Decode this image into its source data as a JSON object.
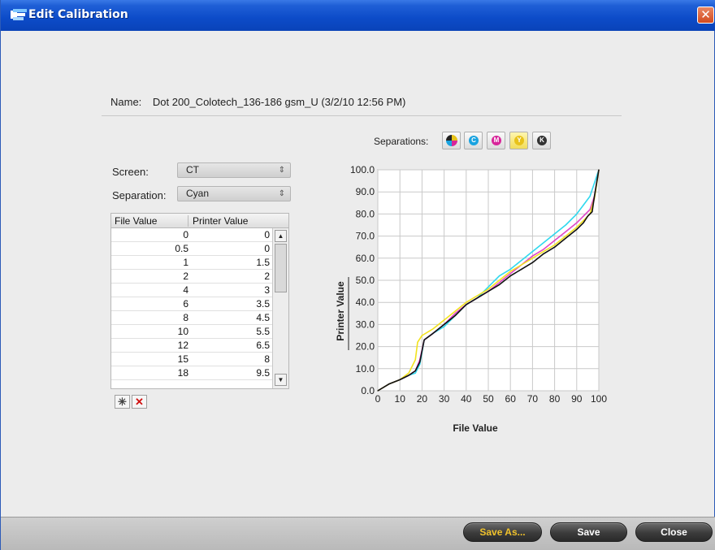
{
  "window": {
    "title": "Edit Calibration",
    "close_glyph": "✕",
    "icon": "app-logo-icon"
  },
  "name_row": {
    "label": "Name:",
    "value": "Dot 200_Colotech_136-186 gsm_U (3/2/10 12:56 PM)"
  },
  "screen": {
    "label": "Screen:",
    "value": "CT"
  },
  "separation": {
    "label": "Separation:",
    "value": "Cyan"
  },
  "table": {
    "headers": [
      "File Value",
      "Printer Value"
    ],
    "rows": [
      [
        "0",
        "0"
      ],
      [
        "0.5",
        "0"
      ],
      [
        "1",
        "1.5"
      ],
      [
        "2",
        "2"
      ],
      [
        "4",
        "3"
      ],
      [
        "6",
        "3.5"
      ],
      [
        "8",
        "4.5"
      ],
      [
        "10",
        "5.5"
      ],
      [
        "12",
        "6.5"
      ],
      [
        "15",
        "8"
      ],
      [
        "18",
        "9.5"
      ]
    ]
  },
  "toolbar": {
    "add_glyph": "✳",
    "delete_glyph": "✕"
  },
  "separations": {
    "label": "Separations:",
    "buttons": [
      {
        "name": "all",
        "glyph": "",
        "color": "multi"
      },
      {
        "name": "cyan",
        "glyph": "C",
        "color": "#1aa3e0"
      },
      {
        "name": "magenta",
        "glyph": "M",
        "color": "#d8259a"
      },
      {
        "name": "yellow",
        "glyph": "Y",
        "color": "#e8c21a"
      },
      {
        "name": "black",
        "glyph": "K",
        "color": "#333333"
      }
    ]
  },
  "chart_data": {
    "type": "line",
    "xlabel": "File Value",
    "ylabel": "Printer Value",
    "xlim": [
      0,
      100
    ],
    "ylim": [
      0,
      100
    ],
    "x_ticks": [
      "0",
      "10",
      "20",
      "30",
      "40",
      "50",
      "60",
      "70",
      "80",
      "90",
      "100"
    ],
    "y_ticks": [
      "0.0",
      "10.0",
      "20.0",
      "30.0",
      "40.0",
      "50.0",
      "60.0",
      "70.0",
      "80.0",
      "90.0",
      "100.0"
    ],
    "grid": true,
    "series": [
      {
        "color": "#2fd8ee",
        "x": [
          0,
          5,
          10,
          14,
          17,
          19,
          21,
          25,
          30,
          35,
          40,
          45,
          50,
          55,
          60,
          65,
          70,
          75,
          80,
          85,
          90,
          93,
          96,
          98,
          100
        ],
        "y": [
          0,
          3,
          5,
          7,
          8,
          12,
          23,
          26,
          29,
          34,
          39,
          42,
          47,
          52,
          55,
          59,
          63,
          67,
          71,
          75,
          80,
          84,
          88,
          94,
          100
        ]
      },
      {
        "color": "#e046c8",
        "x": [
          0,
          5,
          10,
          14,
          17,
          19,
          21,
          25,
          30,
          35,
          40,
          45,
          50,
          55,
          60,
          65,
          70,
          75,
          80,
          85,
          90,
          93,
          96,
          98,
          100
        ],
        "y": [
          0,
          3,
          5,
          7,
          9,
          14,
          23,
          26,
          30,
          35,
          39,
          42,
          45,
          49,
          53,
          57,
          61,
          64,
          68,
          72,
          76,
          79,
          82,
          88,
          100
        ]
      },
      {
        "color": "#f2e21e",
        "x": [
          0,
          5,
          10,
          14,
          17,
          18,
          20,
          25,
          30,
          35,
          40,
          45,
          50,
          55,
          60,
          65,
          70,
          75,
          80,
          85,
          90,
          93,
          96,
          98,
          100
        ],
        "y": [
          0,
          3,
          5,
          8,
          14,
          22,
          25,
          28,
          32,
          36,
          40,
          43,
          46,
          50,
          54,
          57,
          60,
          63,
          66,
          70,
          74,
          77,
          80,
          87,
          100
        ]
      },
      {
        "color": "#111111",
        "x": [
          0,
          5,
          10,
          14,
          17,
          19,
          21,
          25,
          30,
          35,
          40,
          45,
          50,
          55,
          60,
          65,
          70,
          75,
          80,
          85,
          90,
          93,
          95,
          97,
          98,
          100
        ],
        "y": [
          0,
          3,
          5,
          7,
          9,
          13,
          23,
          26,
          30,
          34,
          39,
          42,
          45,
          48,
          52,
          55,
          58,
          62,
          65,
          69,
          73,
          76,
          79,
          81,
          88,
          100
        ]
      }
    ]
  },
  "footer": {
    "save_as": "Save As...",
    "save": "Save",
    "close": "Close"
  },
  "colors": {
    "titlebar": "#0c4bc8",
    "accent_text": "#f0c22b"
  }
}
